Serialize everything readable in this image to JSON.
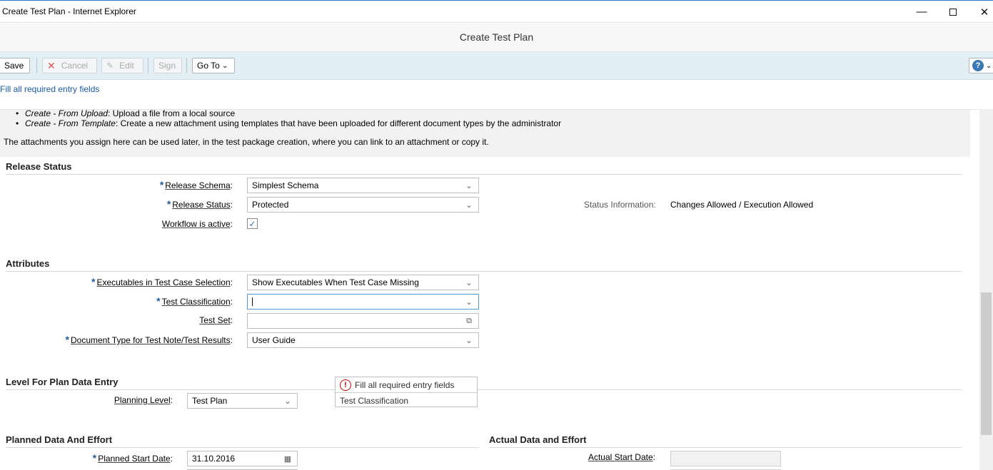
{
  "window": {
    "title": "Create Test Plan - Internet Explorer",
    "minimize_icon": "minimize-icon",
    "maximize_icon": "maximize-icon",
    "close_icon": "close-icon"
  },
  "app": {
    "title": "Create Test Plan"
  },
  "toolbar": {
    "save_label": "Save",
    "cancel_label": "Cancel",
    "edit_label": "Edit",
    "sign_label": "Sign",
    "goto_label": "Go To",
    "help_icon": "help-icon"
  },
  "message_strip": {
    "text": "Fill all required entry fields"
  },
  "help_panel": {
    "item1_term": "Create - From Upload",
    "item1_text": ": Upload a file from a local source",
    "item2_term": "Create - From Template",
    "item2_text": ": Create a new attachment using templates that have been uploaded for different document types by the administrator",
    "note": "The attachments you assign here can be used later, in the test package creation, where you can link to an attachment or copy it."
  },
  "release_status": {
    "title": "Release Status",
    "schema_label": "Release Schema",
    "schema_value": "Simplest Schema",
    "status_label": "Release Status",
    "status_value": "Protected",
    "workflow_label": "Workflow is active",
    "workflow_checked": true,
    "status_info_label": "Status Information:",
    "status_info_value": "Changes Allowed / Execution Allowed"
  },
  "attributes": {
    "title": "Attributes",
    "executables_label": "Executables in Test Case Selection",
    "executables_value": "Show Executables When Test Case Missing",
    "classification_label": "Test Classification",
    "classification_value": "",
    "testset_label": "Test Set",
    "testset_value": "",
    "doctype_label": "Document Type for Test Note/Test Results",
    "doctype_value": "User Guide"
  },
  "level": {
    "title": "Level For Plan Data Entry",
    "planning_label": "Planning Level",
    "planning_value": "Test Plan"
  },
  "error_popup": {
    "message": "Fill all required entry fields",
    "field": "Test Classification"
  },
  "planned": {
    "title": "Planned Data And Effort",
    "start_label": "Planned Start Date",
    "start_value": "31.10.2016"
  },
  "actual": {
    "title": "Actual Data and Effort",
    "start_label": "Actual Start Date",
    "start_value": ""
  }
}
